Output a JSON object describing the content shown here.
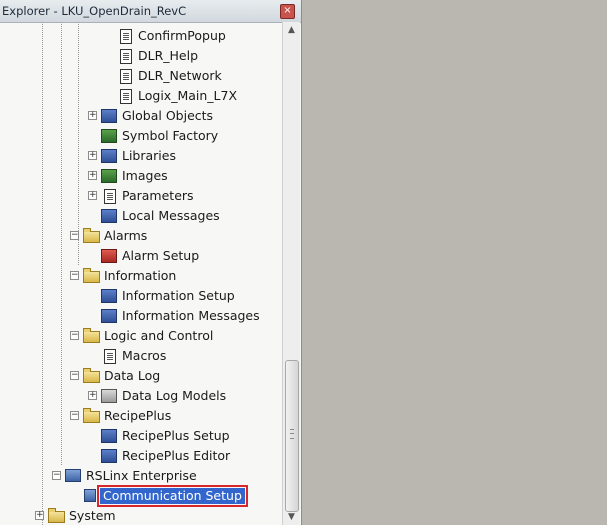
{
  "window": {
    "title": "Explorer - LKU_OpenDrain_RevC",
    "close_label": "×"
  },
  "tree": {
    "items": [
      {
        "label": "ConfirmPopup",
        "icon": "display-doc-icon"
      },
      {
        "label": "DLR_Help",
        "icon": "display-doc-icon"
      },
      {
        "label": "DLR_Network",
        "icon": "display-doc-icon"
      },
      {
        "label": "Logix_Main_L7X",
        "icon": "display-doc-icon"
      },
      {
        "label": "Global Objects",
        "icon": "global-objects-icon"
      },
      {
        "label": "Symbol Factory",
        "icon": "symbol-factory-icon"
      },
      {
        "label": "Libraries",
        "icon": "libraries-icon"
      },
      {
        "label": "Images",
        "icon": "images-icon"
      },
      {
        "label": "Parameters",
        "icon": "parameters-icon"
      },
      {
        "label": "Local Messages",
        "icon": "local-messages-icon"
      },
      {
        "label": "Alarms",
        "icon": "folder-icon"
      },
      {
        "label": "Alarm Setup",
        "icon": "alarm-setup-icon"
      },
      {
        "label": "Information",
        "icon": "folder-icon"
      },
      {
        "label": "Information Setup",
        "icon": "information-setup-icon"
      },
      {
        "label": "Information Messages",
        "icon": "information-messages-icon"
      },
      {
        "label": "Logic and Control",
        "icon": "folder-icon"
      },
      {
        "label": "Macros",
        "icon": "macros-icon"
      },
      {
        "label": "Data Log",
        "icon": "folder-icon"
      },
      {
        "label": "Data Log Models",
        "icon": "data-log-models-icon"
      },
      {
        "label": "RecipePlus",
        "icon": "folder-icon"
      },
      {
        "label": "RecipePlus Setup",
        "icon": "recipeplus-setup-icon"
      },
      {
        "label": "RecipePlus Editor",
        "icon": "recipeplus-editor-icon"
      },
      {
        "label": "RSLinx Enterprise",
        "icon": "rslinx-enterprise-icon"
      },
      {
        "label": "Communication Setup",
        "icon": "communication-setup-icon",
        "selected": true
      },
      {
        "label": "System",
        "icon": "folder-icon"
      }
    ]
  },
  "scrollbar": {
    "up_label": "▲",
    "down_label": "▼"
  },
  "colors": {
    "selection": "#3366cc",
    "highlight_outline": "#d9262b",
    "canvas": "#b9b7b0"
  }
}
